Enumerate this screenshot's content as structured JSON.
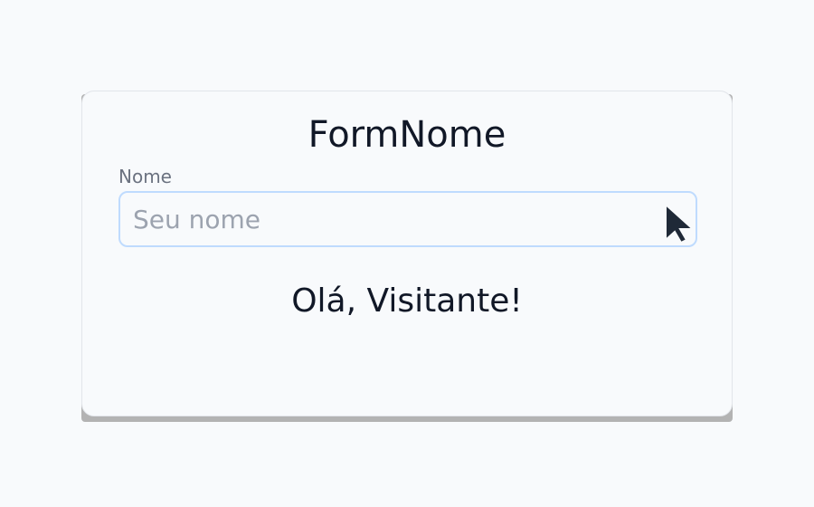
{
  "form": {
    "title": "FormNome",
    "name_field": {
      "label": "Nome",
      "value": "",
      "placeholder": "Seu nome"
    },
    "greeting": "Olá, Visitante!"
  },
  "cursor": {
    "icon": "mouse-pointer-icon"
  },
  "colors": {
    "page_background": "#f8fafc",
    "title_text": "#111827",
    "label_text": "#6b7280",
    "input_border_focus": "#bfdbfe",
    "placeholder_text": "#9ca3af",
    "cursor_fill": "#1f2937"
  }
}
